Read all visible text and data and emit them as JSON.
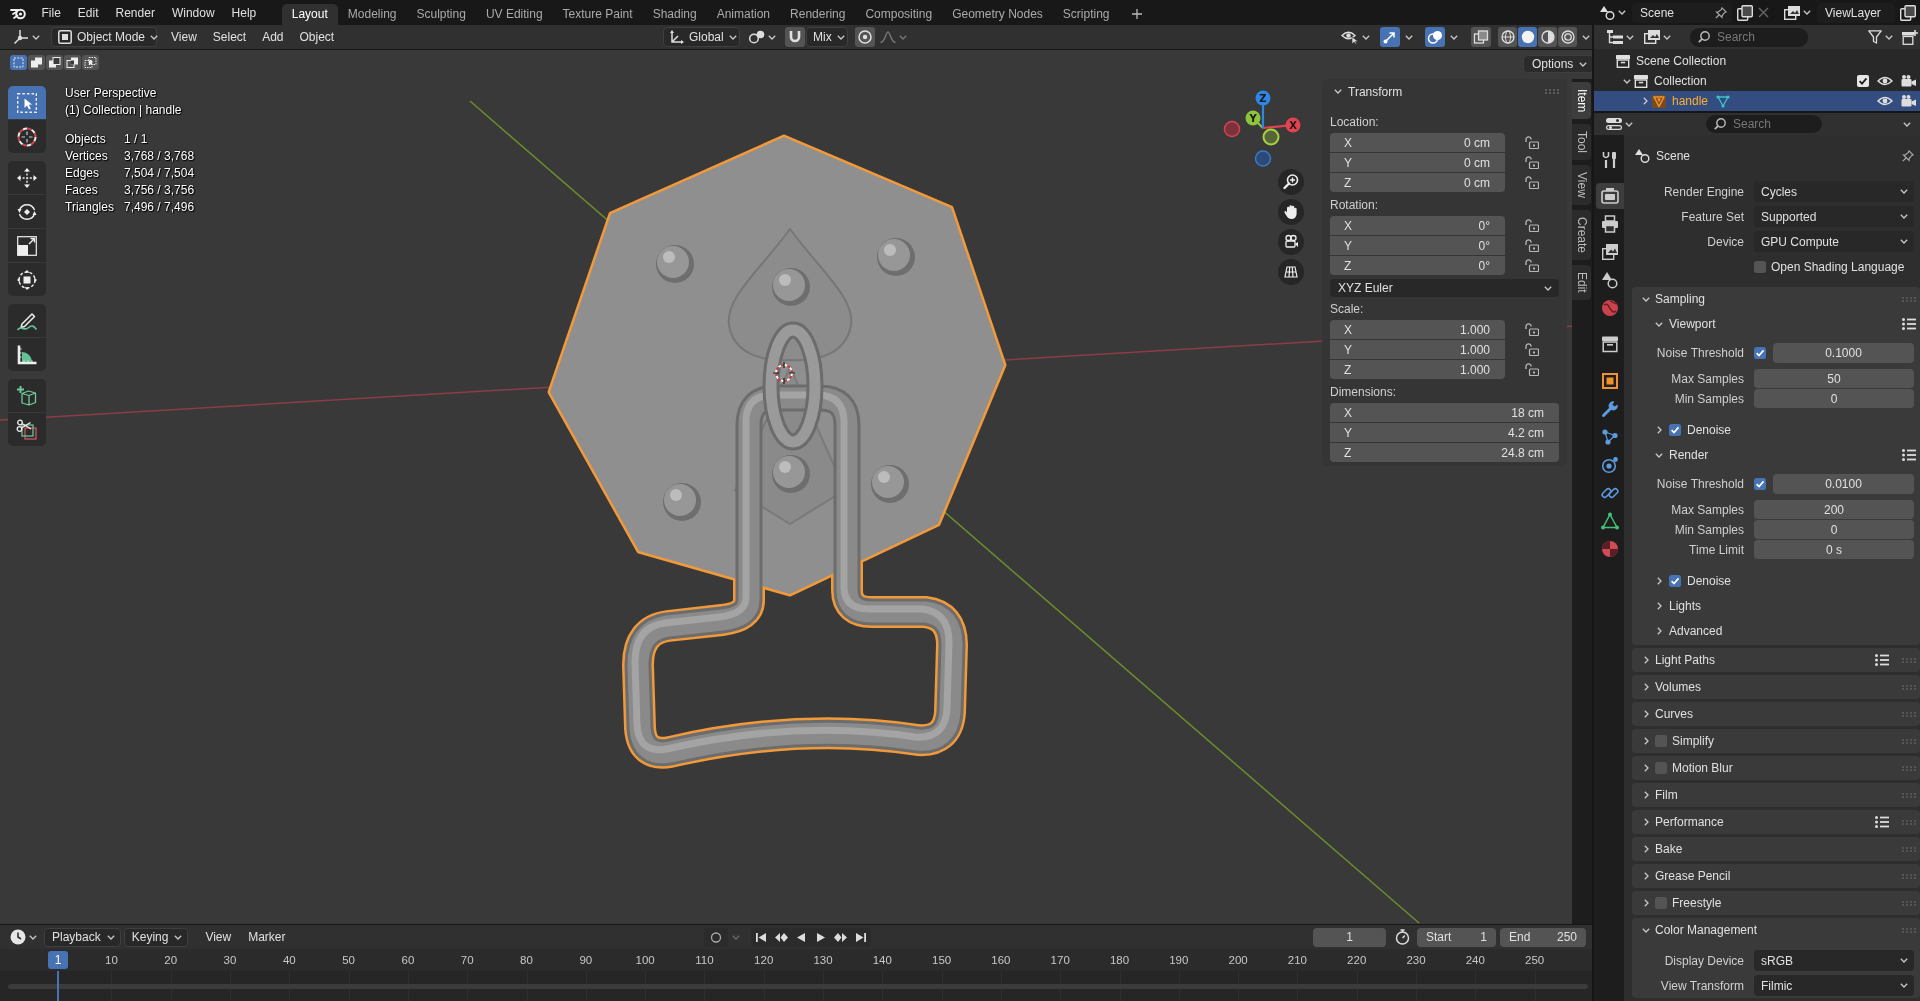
{
  "topbar": {
    "menus": [
      "File",
      "Edit",
      "Render",
      "Window",
      "Help"
    ],
    "workspaces": [
      {
        "label": "Layout",
        "selected": true
      },
      {
        "label": "Modeling",
        "selected": false
      },
      {
        "label": "Sculpting",
        "selected": false
      },
      {
        "label": "UV Editing",
        "selected": false
      },
      {
        "label": "Texture Paint",
        "selected": false
      },
      {
        "label": "Shading",
        "selected": false
      },
      {
        "label": "Animation",
        "selected": false
      },
      {
        "label": "Rendering",
        "selected": false
      },
      {
        "label": "Compositing",
        "selected": false
      },
      {
        "label": "Geometry Nodes",
        "selected": false
      },
      {
        "label": "Scripting",
        "selected": false
      }
    ],
    "scene": "Scene",
    "view_layer": "ViewLayer"
  },
  "viewport_header": {
    "mode": "Object Mode",
    "menus": [
      "View",
      "Select",
      "Add",
      "Object"
    ],
    "orientation": "Global",
    "snap": {
      "on": false,
      "target": "Mix"
    },
    "proportional_editing": {
      "on": false
    },
    "toggles": [
      {
        "kind": "gizmos",
        "on": true
      },
      {
        "kind": "overlays",
        "on": true
      },
      {
        "kind": "xray",
        "on": false
      }
    ],
    "shading_modes": [
      {
        "kind": "wireframe",
        "selected": false
      },
      {
        "kind": "solid",
        "selected": true
      },
      {
        "kind": "material",
        "selected": false
      },
      {
        "kind": "rendered",
        "selected": false
      }
    ],
    "selection_modes": [
      {
        "kind": "new",
        "selected": true
      },
      {
        "kind": "extend",
        "selected": false
      },
      {
        "kind": "subtract",
        "selected": false
      },
      {
        "kind": "invert",
        "selected": false
      },
      {
        "kind": "intersect",
        "selected": false
      }
    ],
    "options": "Options"
  },
  "toolbar": [
    [
      {
        "kind": "select_box",
        "selected": true
      },
      {
        "kind": "cursor",
        "selected": false
      }
    ],
    [
      {
        "kind": "move",
        "selected": false
      },
      {
        "kind": "rotate",
        "selected": false
      },
      {
        "kind": "scale",
        "selected": false
      },
      {
        "kind": "transform",
        "selected": false
      }
    ],
    [
      {
        "kind": "annotate",
        "selected": false
      },
      {
        "kind": "measure",
        "selected": false
      }
    ],
    [
      {
        "kind": "add_cube",
        "selected": false
      },
      {
        "kind": "cut",
        "selected": false
      }
    ]
  ],
  "viewport_info": {
    "view": "User Perspective",
    "context": "(1) Collection | handle",
    "stats": [
      {
        "label": "Objects",
        "value": "1 / 1"
      },
      {
        "label": "Vertices",
        "value": "3,768 / 3,768"
      },
      {
        "label": "Edges",
        "value": "7,504 / 7,504"
      },
      {
        "label": "Faces",
        "value": "3,756 / 3,756"
      },
      {
        "label": "Triangles",
        "value": "7,496 / 7,496"
      }
    ]
  },
  "navigation_gizmo": {
    "axes": [
      {
        "label": "X"
      },
      {
        "label": "Y"
      },
      {
        "label": "Z"
      }
    ]
  },
  "sidebar": {
    "tabs": [
      {
        "label": "Item",
        "selected": true
      },
      {
        "label": "Tool",
        "selected": false
      },
      {
        "label": "View",
        "selected": false
      },
      {
        "label": "Create",
        "selected": false
      },
      {
        "label": "Edit",
        "selected": false
      }
    ],
    "panel": {
      "title": "Transform",
      "expanded": true,
      "groups": [
        {
          "kind": "vector",
          "label": "Location:",
          "fields": [
            {
              "axis": "X",
              "value": "0 cm",
              "locked": false
            },
            {
              "axis": "Y",
              "value": "0 cm",
              "locked": false
            },
            {
              "axis": "Z",
              "value": "0 cm",
              "locked": false
            }
          ]
        },
        {
          "kind": "vector",
          "label": "Rotation:",
          "fields": [
            {
              "axis": "X",
              "value": "0°",
              "locked": false
            },
            {
              "axis": "Y",
              "value": "0°",
              "locked": false
            },
            {
              "axis": "Z",
              "value": "0°",
              "locked": false
            }
          ]
        },
        {
          "kind": "dropdown",
          "value": "XYZ Euler"
        },
        {
          "kind": "vector",
          "label": "Scale:",
          "fields": [
            {
              "axis": "X",
              "value": "1.000",
              "locked": false
            },
            {
              "axis": "Y",
              "value": "1.000",
              "locked": false
            },
            {
              "axis": "Z",
              "value": "1.000",
              "locked": false
            }
          ]
        },
        {
          "kind": "vector",
          "label": "Dimensions:",
          "fields": [
            {
              "axis": "X",
              "value": "18 cm"
            },
            {
              "axis": "Y",
              "value": "4.2 cm"
            },
            {
              "axis": "Z",
              "value": "24.8 cm"
            }
          ]
        }
      ]
    }
  },
  "outliner": {
    "search": {
      "placeholder": "Search"
    },
    "tree": [
      {
        "kind": "scene_collection",
        "label": "Scene Collection",
        "selected": false,
        "children": [
          {
            "kind": "collection",
            "label": "Collection",
            "selected": false,
            "expanded": true,
            "included": true,
            "visible": true,
            "renderable": true,
            "children": [
              {
                "kind": "mesh_object",
                "label": "handle",
                "selected": true,
                "expanded": false,
                "visible": true,
                "renderable": true
              }
            ]
          }
        ]
      }
    ]
  },
  "properties": {
    "search": {
      "placeholder": "Search"
    },
    "tabs": [
      {
        "kind": "tool",
        "selected": false
      },
      {
        "kind": "render",
        "selected": true
      },
      {
        "kind": "output",
        "selected": false
      },
      {
        "kind": "view_layer",
        "selected": false
      },
      {
        "kind": "scene",
        "selected": false
      },
      {
        "kind": "world",
        "selected": false
      },
      {
        "kind": "collection",
        "selected": false
      },
      {
        "kind": "object",
        "selected": false
      },
      {
        "kind": "modifiers",
        "selected": false
      },
      {
        "kind": "particles",
        "selected": false
      },
      {
        "kind": "physics",
        "selected": false
      },
      {
        "kind": "constraints",
        "selected": false
      },
      {
        "kind": "data",
        "selected": false
      },
      {
        "kind": "material",
        "selected": false
      }
    ],
    "context": "Scene",
    "items": [
      {
        "kind": "dropdown",
        "label": "Render Engine",
        "value": "Cycles"
      },
      {
        "kind": "dropdown",
        "label": "Feature Set",
        "value": "Supported"
      },
      {
        "kind": "dropdown",
        "label": "Device",
        "value": "GPU Compute"
      },
      {
        "kind": "checkbox",
        "label": "Open Shading Language",
        "checked": false
      },
      {
        "kind": "panel",
        "title": "Sampling",
        "expanded": true,
        "presets": false,
        "children": [
          {
            "kind": "panel",
            "title": "Viewport",
            "expanded": true,
            "presets": true,
            "children": [
              {
                "kind": "toggle_number",
                "label": "Noise Threshold",
                "checked": true,
                "value": "0.1000"
              },
              {
                "kind": "number",
                "label": "Max Samples",
                "value": "50"
              },
              {
                "kind": "number",
                "label": "Min Samples",
                "value": "0"
              },
              {
                "kind": "toggle_panel",
                "title": "Denoise",
                "expanded": false,
                "checked": true,
                "presets": false
              }
            ]
          },
          {
            "kind": "panel",
            "title": "Render",
            "expanded": true,
            "presets": true,
            "children": [
              {
                "kind": "toggle_number",
                "label": "Noise Threshold",
                "checked": true,
                "value": "0.0100"
              },
              {
                "kind": "number",
                "label": "Max Samples",
                "value": "200"
              },
              {
                "kind": "number",
                "label": "Min Samples",
                "value": "0"
              },
              {
                "kind": "number",
                "label": "Time Limit",
                "value": "0 s"
              },
              {
                "kind": "toggle_panel",
                "title": "Denoise",
                "expanded": false,
                "checked": true,
                "presets": false
              }
            ]
          },
          {
            "kind": "panel",
            "title": "Lights",
            "expanded": false,
            "presets": false
          },
          {
            "kind": "panel",
            "title": "Advanced",
            "expanded": false,
            "presets": false
          }
        ]
      },
      {
        "kind": "panel",
        "title": "Light Paths",
        "expanded": false,
        "presets": true
      },
      {
        "kind": "panel",
        "title": "Volumes",
        "expanded": false,
        "presets": false
      },
      {
        "kind": "panel",
        "title": "Curves",
        "expanded": false,
        "presets": false
      },
      {
        "kind": "toggle_panel",
        "title": "Simplify",
        "expanded": false,
        "checked": false,
        "presets": false
      },
      {
        "kind": "toggle_panel",
        "title": "Motion Blur",
        "expanded": false,
        "checked": false,
        "presets": false
      },
      {
        "kind": "panel",
        "title": "Film",
        "expanded": false,
        "presets": false
      },
      {
        "kind": "panel",
        "title": "Performance",
        "expanded": false,
        "presets": true
      },
      {
        "kind": "panel",
        "title": "Bake",
        "expanded": false,
        "presets": false
      },
      {
        "kind": "panel",
        "title": "Grease Pencil",
        "expanded": false,
        "presets": false
      },
      {
        "kind": "toggle_panel",
        "title": "Freestyle",
        "expanded": false,
        "checked": false,
        "presets": false
      },
      {
        "kind": "panel",
        "title": "Color Management",
        "expanded": true,
        "presets": false,
        "children": [
          {
            "kind": "dropdown",
            "label": "Display Device",
            "value": "sRGB"
          },
          {
            "kind": "dropdown",
            "label": "View Transform",
            "value": "Filmic"
          }
        ]
      }
    ]
  },
  "timeline": {
    "menus": [
      {
        "kind": "dropdown",
        "label": "Playback"
      },
      {
        "kind": "dropdown",
        "label": "Keying"
      },
      {
        "kind": "menu",
        "label": "View"
      },
      {
        "kind": "menu",
        "label": "Marker"
      }
    ],
    "auto_keying": false,
    "current_frame": "1",
    "start": {
      "label": "Start",
      "value": "1"
    },
    "end": {
      "label": "End",
      "value": "250"
    },
    "ruler": [
      "10",
      "20",
      "30",
      "40",
      "50",
      "60",
      "70",
      "80",
      "90",
      "100",
      "110",
      "120",
      "130",
      "140",
      "150",
      "160",
      "170",
      "180",
      "190",
      "200",
      "210",
      "220",
      "230",
      "240",
      "250"
    ],
    "playhead": "1"
  }
}
